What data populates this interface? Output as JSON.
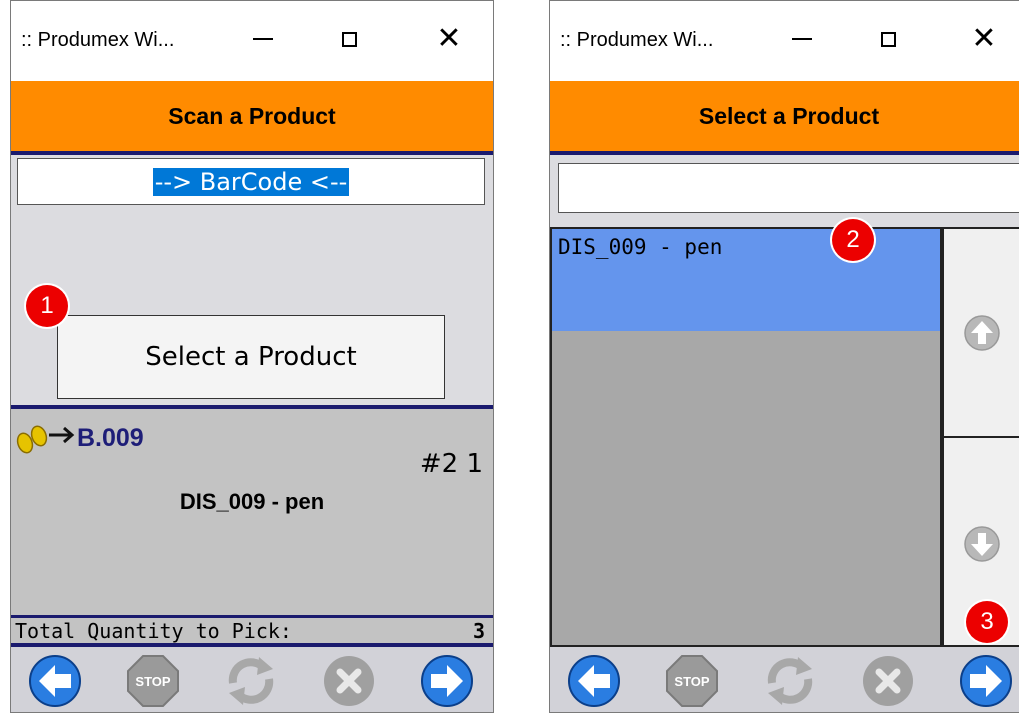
{
  "window1": {
    "title": ":: Produmex Wi...",
    "header": "Scan a Product",
    "barcode_value": "--> BarCode <--",
    "select_button": "Select a Product",
    "location": "B.009",
    "count": "#2 1",
    "product": "DIS_009 - pen",
    "total_label": "Total Quantity to Pick:",
    "total_value": "3",
    "toolbar": [
      "back-arrow-icon",
      "stop-icon",
      "refresh-icon",
      "cancel-icon",
      "forward-arrow-icon"
    ]
  },
  "window2": {
    "title": ":: Produmex Wi...",
    "header": "Select a Product",
    "search_value": "",
    "list_items": [
      "DIS_009 - pen"
    ],
    "toolbar": [
      "back-arrow-icon",
      "stop-icon",
      "refresh-icon",
      "cancel-icon",
      "forward-arrow-icon"
    ]
  },
  "badges": [
    "1",
    "2",
    "3"
  ],
  "colors": {
    "header_bg": "#ff8b00",
    "accent_navy": "#1a1a6e",
    "selection_blue": "#0078d7",
    "list_selected": "#6495ed",
    "badge_red": "#ec0000"
  }
}
